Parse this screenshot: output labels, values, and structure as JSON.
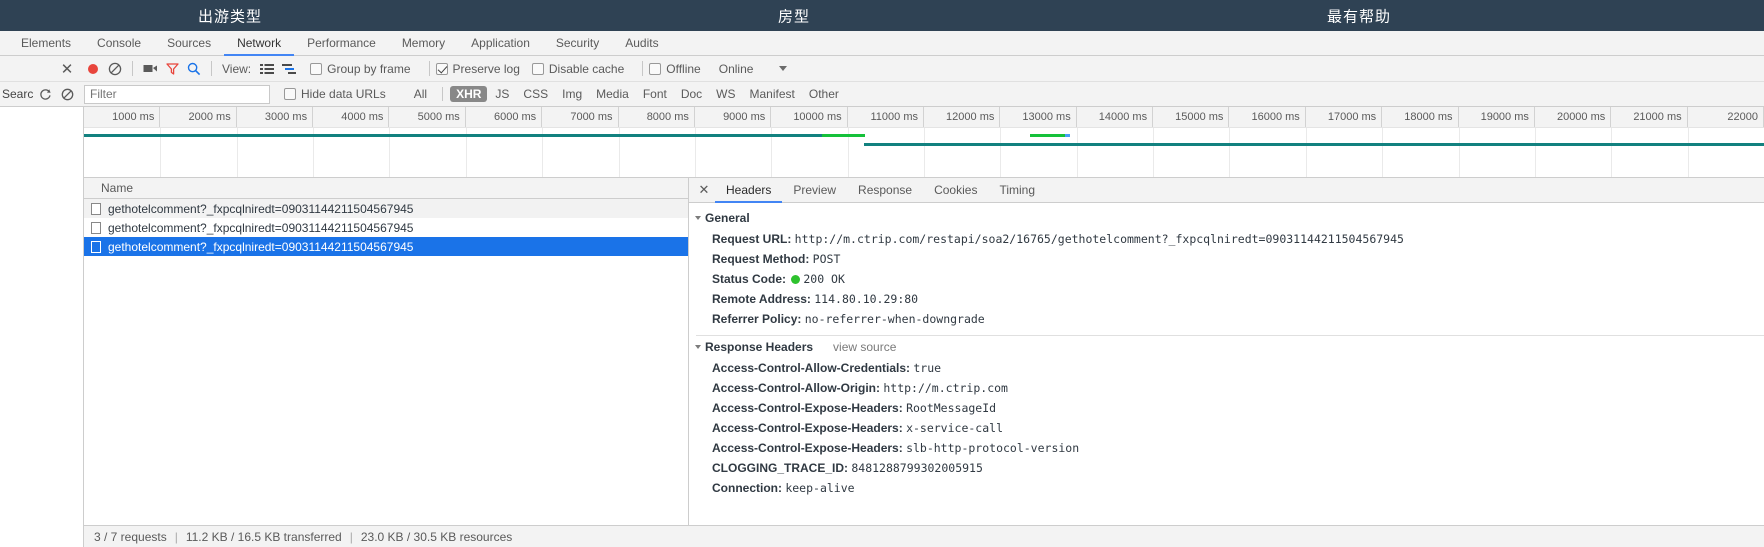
{
  "page_header": {
    "items": [
      {
        "label": "出游类型"
      },
      {
        "label": "房型"
      },
      {
        "label": "最有帮助"
      }
    ],
    "background": "#2f4254"
  },
  "devtools": {
    "tabs": [
      {
        "label": "Elements",
        "active": false
      },
      {
        "label": "Console",
        "active": false
      },
      {
        "label": "Sources",
        "active": false
      },
      {
        "label": "Network",
        "active": true
      },
      {
        "label": "Performance",
        "active": false
      },
      {
        "label": "Memory",
        "active": false
      },
      {
        "label": "Application",
        "active": false
      },
      {
        "label": "Security",
        "active": false
      },
      {
        "label": "Audits",
        "active": false
      }
    ],
    "toolbar": {
      "close_label": "✕",
      "record_icon": "record-icon",
      "clear_icon": "clear-icon",
      "camera_icon": "camera-icon",
      "filter_icon": "filter-icon",
      "search_icon": "search-icon",
      "view_label": "View:",
      "view_list_icon": "list-view-icon",
      "view_waterfall_icon": "waterfall-view-icon",
      "group_by_frame": {
        "label": "Group by frame",
        "checked": false
      },
      "preserve_log": {
        "label": "Preserve log",
        "checked": true
      },
      "disable_cache": {
        "label": "Disable cache",
        "checked": false
      },
      "offline": {
        "label": "Offline",
        "checked": false
      },
      "throttling": {
        "label": "Online",
        "caret_icon": "chevron-down-icon"
      }
    },
    "filterbar": {
      "search_label": "Search",
      "refresh_icon": "refresh-icon",
      "clear_icon": "no-entry-icon",
      "filter_placeholder": "Filter",
      "filter_value": "",
      "hide_data_urls": {
        "label": "Hide data URLs",
        "checked": false
      },
      "types": [
        {
          "label": "All",
          "active": false
        },
        {
          "label": "XHR",
          "active": true
        },
        {
          "label": "JS",
          "active": false
        },
        {
          "label": "CSS",
          "active": false
        },
        {
          "label": "Img",
          "active": false
        },
        {
          "label": "Media",
          "active": false
        },
        {
          "label": "Font",
          "active": false
        },
        {
          "label": "Doc",
          "active": false
        },
        {
          "label": "WS",
          "active": false
        },
        {
          "label": "Manifest",
          "active": false
        },
        {
          "label": "Other",
          "active": false
        }
      ]
    },
    "overview": {
      "ticks": [
        "1000 ms",
        "2000 ms",
        "3000 ms",
        "4000 ms",
        "5000 ms",
        "6000 ms",
        "7000 ms",
        "8000 ms",
        "9000 ms",
        "10000 ms",
        "11000 ms",
        "12000 ms",
        "13000 ms",
        "14000 ms",
        "15000 ms",
        "16000 ms",
        "17000 ms",
        "18000 ms",
        "19000 ms",
        "20000 ms",
        "21000 ms",
        "22000"
      ],
      "bars": [
        {
          "kind": "teal",
          "left_pct": 0.0,
          "width_pct": 43.9,
          "row": 0
        },
        {
          "kind": "green",
          "left_pct": 43.9,
          "width_pct": 2.6,
          "row": 0
        },
        {
          "kind": "green",
          "left_pct": 56.3,
          "width_pct": 2.1,
          "row": 0
        },
        {
          "kind": "blue",
          "left_pct": 58.4,
          "width_pct": 0.3,
          "row": 0
        },
        {
          "kind": "green",
          "left_pct": 46.8,
          "width_pct": 2.4,
          "row": 1
        },
        {
          "kind": "teal",
          "left_pct": 46.4,
          "width_pct": 53.6,
          "row": 1
        }
      ]
    },
    "requests": {
      "column_header": "Name",
      "rows": [
        {
          "name": "gethotelcomment?_fxpcqlniredt=09031144211504567945",
          "selected": false
        },
        {
          "name": "gethotelcomment?_fxpcqlniredt=09031144211504567945",
          "selected": false
        },
        {
          "name": "gethotelcomment?_fxpcqlniredt=09031144211504567945",
          "selected": true
        }
      ]
    },
    "detail": {
      "close_label": "✕",
      "tabs": [
        {
          "label": "Headers",
          "active": true
        },
        {
          "label": "Preview",
          "active": false
        },
        {
          "label": "Response",
          "active": false
        },
        {
          "label": "Cookies",
          "active": false
        },
        {
          "label": "Timing",
          "active": false
        }
      ],
      "general": {
        "title": "General",
        "rows": [
          {
            "name": "Request URL:",
            "value": "http://m.ctrip.com/restapi/soa2/16765/gethotelcomment?_fxpcqlniredt=09031144211504567945",
            "status_dot": false
          },
          {
            "name": "Request Method:",
            "value": "POST",
            "status_dot": false
          },
          {
            "name": "Status Code:",
            "value": "200 OK",
            "status_dot": true
          },
          {
            "name": "Remote Address:",
            "value": "114.80.10.29:80",
            "status_dot": false
          },
          {
            "name": "Referrer Policy:",
            "value": "no-referrer-when-downgrade",
            "status_dot": false
          }
        ]
      },
      "response_headers": {
        "title": "Response Headers",
        "view_source": "view source",
        "rows": [
          {
            "name": "Access-Control-Allow-Credentials:",
            "value": "true"
          },
          {
            "name": "Access-Control-Allow-Origin:",
            "value": "http://m.ctrip.com"
          },
          {
            "name": "Access-Control-Expose-Headers:",
            "value": "RootMessageId"
          },
          {
            "name": "Access-Control-Expose-Headers:",
            "value": "x-service-call"
          },
          {
            "name": "Access-Control-Expose-Headers:",
            "value": "slb-http-protocol-version"
          },
          {
            "name": "CLOGGING_TRACE_ID:",
            "value": "8481288799302005915"
          },
          {
            "name": "Connection:",
            "value": "keep-alive"
          }
        ]
      }
    },
    "statusbar": {
      "requests": "3 / 7 requests",
      "transferred": "11.2 KB / 16.5 KB transferred",
      "resources": "23.0 KB / 30.5 KB resources"
    }
  }
}
